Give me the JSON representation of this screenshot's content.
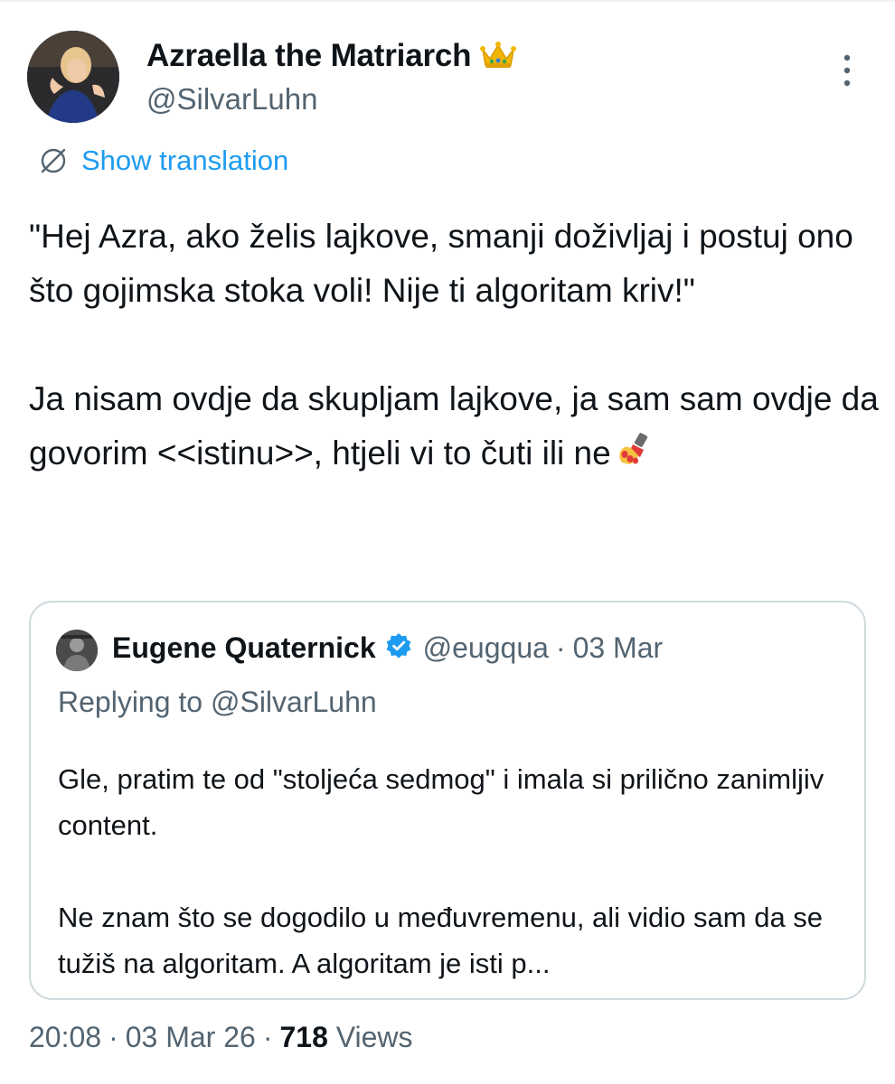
{
  "author": {
    "display_name": "Azraella the Matriarch",
    "handle": "@SilvarLuhn",
    "badge_icon": "crown-icon"
  },
  "translation": {
    "label": "Show translation",
    "icon": "globe-slash-icon",
    "color": "#1d9bf0"
  },
  "tweet": {
    "paragraph_1": "\"Hej Azra, ako želis lajkove, smanji doživljaj i postuj ono što gojimska stoka voli! Nije ti algoritam kriv!\"",
    "paragraph_2": "Ja nisam ovdje da skupljam lajkove, ja sam sam ovdje da govorim <<istinu>>, htjeli vi to čuti ili ne",
    "emoji_icon": "nail-polish-icon"
  },
  "quote": {
    "display_name": "Eugene Quaternick",
    "verified_icon": "verified-badge-icon",
    "handle": "@eugqua",
    "separator": "·",
    "date": "03 Mar",
    "replying_to": "Replying to @SilvarLuhn",
    "paragraph_1": "Gle, pratim te od \"stoljeća sedmog\" i imala si prilično zanimljiv content.",
    "paragraph_2": "Ne znam što se dogodilo u međuvremenu, ali vidio sam da se tužiš na algoritam. A algoritam je isti p..."
  },
  "meta": {
    "time": "20:08",
    "separator": "·",
    "date": "03 Mar 26",
    "views_count": "718",
    "views_label": "Views"
  },
  "colors": {
    "text_primary": "#0f1419",
    "text_secondary": "#536471",
    "link": "#1d9bf0",
    "border": "#cfd9de",
    "verified": "#1d9bf0"
  }
}
